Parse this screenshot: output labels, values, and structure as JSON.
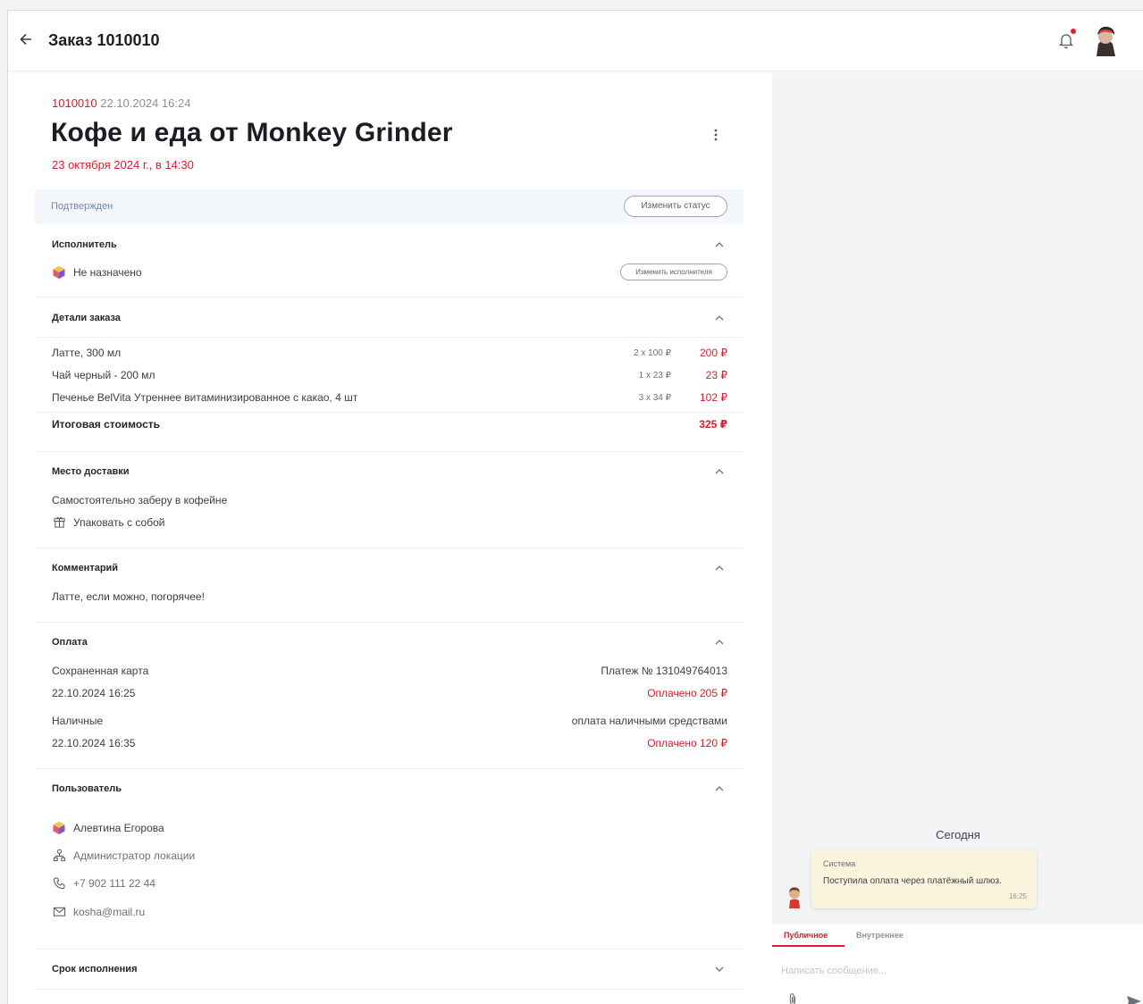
{
  "header": {
    "title": "Заказ 1010010"
  },
  "order": {
    "number": "1010010",
    "created": "22.10.2024 16:24",
    "title": "Кофе и еда от Monkey Grinder",
    "scheduled": "23 октября 2024 г., в 14:30",
    "status": "Подтвержден",
    "change_status_label": "Изменить статус"
  },
  "executor": {
    "title": "Исполнитель",
    "value": "Не назначено",
    "change_label": "Изменить исполнителя"
  },
  "details": {
    "title": "Детали заказа",
    "items": [
      {
        "name": "Латте, 300 мл",
        "qty": "2 x 100 ₽",
        "sum": "200 ₽"
      },
      {
        "name": "Чай черный - 200 мл",
        "qty": "1 x 23 ₽",
        "sum": "23 ₽"
      },
      {
        "name": "Печенье BelVita Утреннее витаминизированное с какао, 4 шт",
        "qty": "3 x 34 ₽",
        "sum": "102 ₽"
      }
    ],
    "total_label": "Итоговая стоимость",
    "total_value": "325 ₽"
  },
  "delivery": {
    "title": "Место доставки",
    "value": "Самостоятельно заберу в кофейне",
    "pack": "Упаковать с собой"
  },
  "comment": {
    "title": "Комментарий",
    "value": "Латте, если можно, погорячее!"
  },
  "payment": {
    "title": "Оплата",
    "entries": [
      {
        "method": "Сохраненная карта",
        "date": "22.10.2024 16:25",
        "info": "Платеж № 131049764013",
        "paid": "Оплачено 205 ₽"
      },
      {
        "method": "Наличные",
        "date": "22.10.2024 16:35",
        "info": "оплата наличными средствами",
        "paid": "Оплачено 120 ₽"
      }
    ]
  },
  "user": {
    "title": "Пользователь",
    "name": "Алевтина Егорова",
    "role": "Администратор локации",
    "phone": "+7 902 111 22 44",
    "email": "kosha@mail.ru"
  },
  "deadline": {
    "title": "Срок исполнения"
  },
  "chat": {
    "day_label": "Сегодня",
    "messages": [
      {
        "author": "Система",
        "text": "Поступила оплата через платёжный шлюз.",
        "time": "16:25"
      }
    ],
    "tabs": [
      {
        "label": "Публичное"
      },
      {
        "label": "Внутреннее"
      }
    ],
    "input_placeholder": "Написать сообщение..."
  },
  "colors": {
    "accent": "#d21f2e",
    "status_bg": "#f3f6fa",
    "system_bubble": "#fbf4dc"
  }
}
